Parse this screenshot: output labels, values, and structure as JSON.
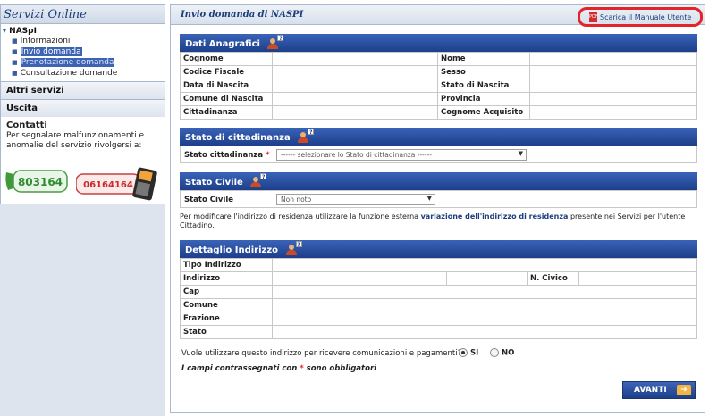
{
  "sidebar": {
    "header": "Servizi Online",
    "group_title": "NASpI",
    "items": [
      {
        "label": "Informazioni"
      },
      {
        "label": "Invio domanda"
      },
      {
        "label": "Prenotazione domanda"
      },
      {
        "label": "Consultazione domande"
      }
    ],
    "other_services": "Altri servizi",
    "exit": "Uscita",
    "contacts": {
      "title": "Contatti",
      "text": "Per segnalare malfunzionamenti e anomalie del servizio rivolgersi a:",
      "phone_green": "803164",
      "phone_red": "06164164"
    }
  },
  "main": {
    "title": "Invio domanda di NASPI",
    "manual_link": "Scarica il Manuale Utente",
    "pdf_icon": "PDF",
    "dati_anagrafici": {
      "title": "Dati Anagrafici",
      "rows": [
        {
          "left": "Cognome",
          "right": "Nome"
        },
        {
          "left": "Codice Fiscale",
          "right": "Sesso"
        },
        {
          "left": "Data di Nascita",
          "right": "Stato di Nascita"
        },
        {
          "left": "Comune di Nascita",
          "right": "Provincia"
        },
        {
          "left": "Cittadinanza",
          "right": "Cognome Acquisito"
        }
      ]
    },
    "stato_cittadinanza": {
      "title": "Stato di cittadinanza",
      "label": "Stato cittadinanza",
      "required_mark": "*",
      "select_value": "------ selezionare lo Stato di cittadinanza ------"
    },
    "stato_civile": {
      "title": "Stato Civile",
      "label": "Stato Civile",
      "select_value": "Non noto"
    },
    "note": {
      "before": "Per modificare l'indirizzo di residenza utilizzare la funzione esterna ",
      "link": "variazione dell'indirizzo di residenza",
      "after": " presente nei Servizi per l'utente Cittadino."
    },
    "dettaglio_indirizzo": {
      "title": "Dettaglio Indirizzo",
      "rows": [
        "Tipo Indirizzo",
        "Indirizzo",
        "Cap",
        "Comune",
        "Frazione",
        "Stato"
      ],
      "civico_label": "N. Civico"
    },
    "question": "Vuole utilizzare questo indirizzo per ricevere comunicazioni e pagamenti?",
    "option_yes": "SI",
    "option_no": "NO",
    "selected_option": "SI",
    "footnote_before": "I campi contrassegnati con ",
    "footnote_mark": "*",
    "footnote_after": " sono obbligatori",
    "next_button": "AVANTI",
    "next_arrow": "➔"
  },
  "icons": {
    "chevron": "chevron-down-icon",
    "person_help": "person-help-icon",
    "phone": "phone-icon",
    "pdf": "pdf-icon"
  },
  "colors": {
    "header_blue": "#1d3f8a",
    "highlight": "#3d63b3",
    "annotation_red": "#e3242b"
  }
}
